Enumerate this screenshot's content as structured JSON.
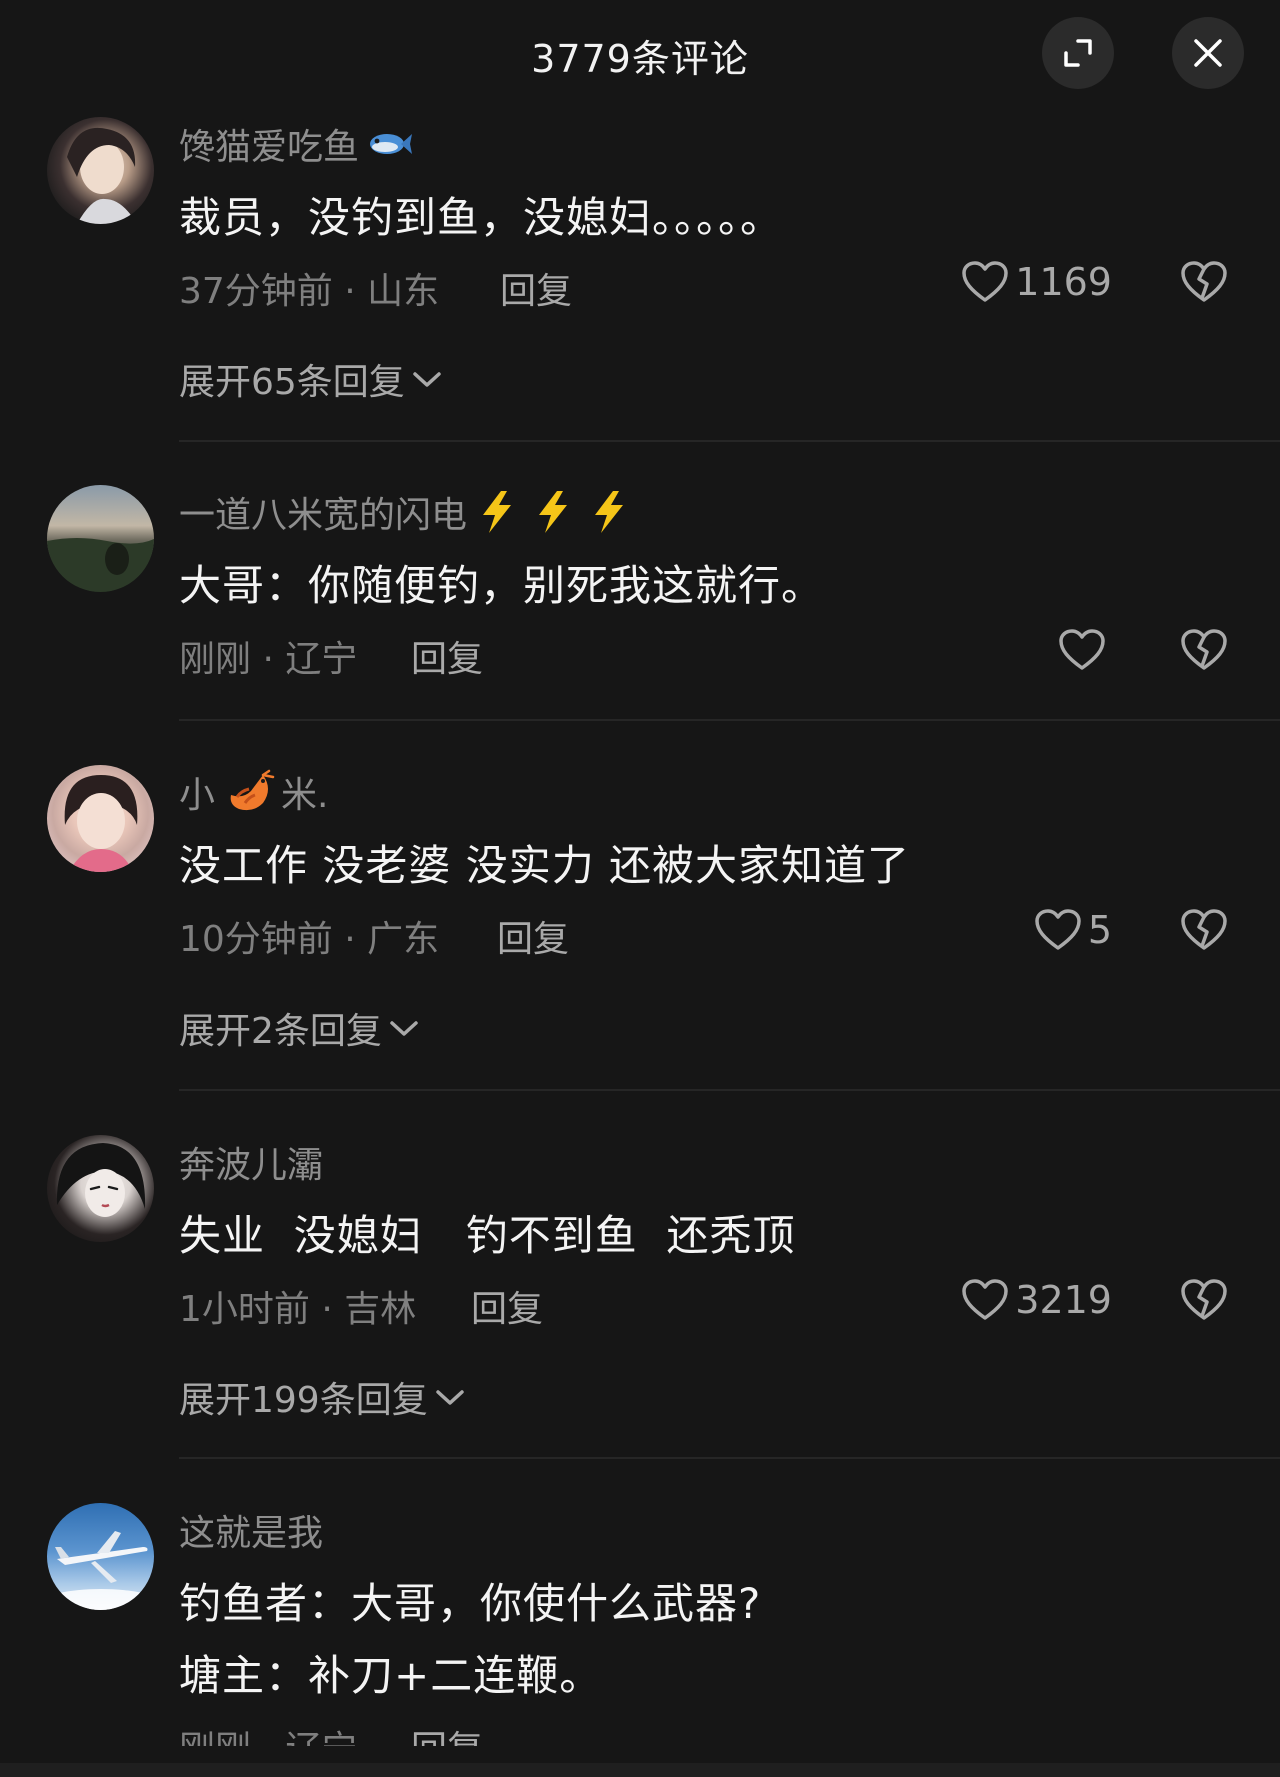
{
  "header": {
    "title": "3779条评论",
    "expand_icon": "expand-icon",
    "close_icon": "close-icon"
  },
  "comments": [
    {
      "username": "馋猫爱吃鱼",
      "username_emoji": "fish",
      "text": "裁员，没钓到鱼，没媳妇。。。。。",
      "meta": "37分钟前 · 山东",
      "reply_label": "回复",
      "likes": "1169",
      "expand_label": "展开65条回复"
    },
    {
      "username": "一道八米宽的闪电",
      "username_emoji": "lightning x3",
      "text": "大哥：你随便钓，别死我这就行。",
      "meta": "刚刚 · 辽宁",
      "reply_label": "回复",
      "likes": ""
    },
    {
      "username_prefix": "小",
      "username_emoji": "shrimp",
      "username_suffix": "米.",
      "text": "没工作 没老婆 没实力 还被大家知道了",
      "meta": "10分钟前 · 广东",
      "reply_label": "回复",
      "likes": "5",
      "expand_label": "展开2条回复"
    },
    {
      "username": "奔波儿灞",
      "text": "失业  没媳妇   钓不到鱼  还秃顶",
      "meta": "1小时前 · 吉林",
      "reply_label": "回复",
      "likes": "3219",
      "expand_label": "展开199条回复"
    },
    {
      "username": "这就是我",
      "text_line1": "钓鱼者：大哥，你使什么武器?",
      "text_line2": "塘主：补刀+二连鞭。",
      "meta": "刚刚 · 辽宁",
      "reply_label": "回复"
    }
  ],
  "colors": {
    "background": "#161616",
    "username": "#8e8e8e",
    "text": "#f4f4f4",
    "meta": "#7f7f7f",
    "action": "#a9a9a9"
  }
}
